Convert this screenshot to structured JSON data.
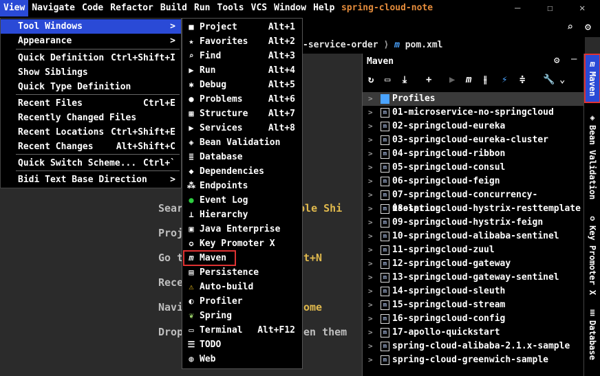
{
  "menubar": {
    "items": [
      "View",
      "Navigate",
      "Code",
      "Refactor",
      "Build",
      "Run",
      "Tools",
      "VCS",
      "Window",
      "Help"
    ],
    "app_title": "spring-cloud-note",
    "minimize": "—",
    "maximize": "☐",
    "close": "✕"
  },
  "breadcrumb": {
    "part1": "-service-order",
    "sep": "⟩",
    "logo": "m",
    "file": "pom.xml"
  },
  "editor_hints": {
    "h1a": "Sear",
    "h1b": "uble Shi",
    "h2": "Proj",
    "h3a": "Go t",
    "h3b": "t+N",
    "h4": "Rece",
    "h5a": "Navi",
    "h5b": "ome",
    "h6a": "Drop",
    "h6b": "en them"
  },
  "view_menu": {
    "items": [
      {
        "label": "Tool Windows",
        "shortcut": "",
        "arrow": ">"
      },
      {
        "label": "Appearance",
        "shortcut": "",
        "arrow": ">"
      },
      {
        "label": "Quick Definition",
        "shortcut": "Ctrl+Shift+I"
      },
      {
        "label": "Show Siblings",
        "shortcut": ""
      },
      {
        "label": "Quick Type Definition",
        "shortcut": ""
      },
      {
        "label": "Recent Files",
        "shortcut": "Ctrl+E"
      },
      {
        "label": "Recently Changed Files",
        "shortcut": ""
      },
      {
        "label": "Recent Locations",
        "shortcut": "Ctrl+Shift+E"
      },
      {
        "label": "Recent Changes",
        "shortcut": "Alt+Shift+C"
      },
      {
        "label": "Quick Switch Scheme...",
        "shortcut": "Ctrl+`"
      },
      {
        "label": "Bidi Text Base Direction",
        "shortcut": "",
        "arrow": ">"
      }
    ]
  },
  "tool_windows_menu": {
    "items": [
      {
        "label": "Project",
        "shortcut": "Alt+1",
        "icon": "■"
      },
      {
        "label": "Favorites",
        "shortcut": "Alt+2",
        "icon": "★"
      },
      {
        "label": "Find",
        "shortcut": "Alt+3",
        "icon": "⌕"
      },
      {
        "label": "Run",
        "shortcut": "Alt+4",
        "icon": "▶"
      },
      {
        "label": "Debug",
        "shortcut": "Alt+5",
        "icon": "✱"
      },
      {
        "label": "Problems",
        "shortcut": "Alt+6",
        "icon": "●"
      },
      {
        "label": "Structure",
        "shortcut": "Alt+7",
        "icon": "▦"
      },
      {
        "label": "Services",
        "shortcut": "Alt+8",
        "icon": "▶"
      },
      {
        "label": "Bean Validation",
        "shortcut": "",
        "icon": "◈"
      },
      {
        "label": "Database",
        "shortcut": "",
        "icon": "≣"
      },
      {
        "label": "Dependencies",
        "shortcut": "",
        "icon": "◆"
      },
      {
        "label": "Endpoints",
        "shortcut": "",
        "icon": "⁂"
      },
      {
        "label": "Event Log",
        "shortcut": "",
        "icon": "●"
      },
      {
        "label": "Hierarchy",
        "shortcut": "",
        "icon": "⊥"
      },
      {
        "label": "Java Enterprise",
        "shortcut": "",
        "icon": "▣"
      },
      {
        "label": "Key Promoter X",
        "shortcut": "",
        "icon": "✪"
      },
      {
        "label": "Maven",
        "shortcut": "",
        "icon": "m"
      },
      {
        "label": "Persistence",
        "shortcut": "",
        "icon": "▤"
      },
      {
        "label": "Auto-build",
        "shortcut": "",
        "icon": "⚠"
      },
      {
        "label": "Profiler",
        "shortcut": "",
        "icon": "◐"
      },
      {
        "label": "Spring",
        "shortcut": "",
        "icon": "❦"
      },
      {
        "label": "Terminal",
        "shortcut": "Alt+F12",
        "icon": "▭"
      },
      {
        "label": "TODO",
        "shortcut": "",
        "icon": "☰"
      },
      {
        "label": "Web",
        "shortcut": "",
        "icon": "◍"
      }
    ]
  },
  "maven": {
    "title": "Maven",
    "profiles_label": "Profiles",
    "projects": [
      "01-microservice-no-springcloud",
      "02-springcloud-eureka",
      "03-springcloud-eureka-cluster",
      "04-springcloud-ribbon",
      "05-springcloud-consul",
      "06-springcloud-feign",
      "07-springcloud-concurrency-isolation",
      "08-springcloud-hystrix-resttemplate",
      "09-springcloud-hystrix-feign",
      "10-springcloud-alibaba-sentinel",
      "11-springcloud-zuul",
      "12-springcloud-gateway",
      "13-springcloud-gateway-sentinel",
      "14-springcloud-sleuth",
      "15-springcloud-stream",
      "16-springcloud-config",
      "17-apollo-quickstart",
      "spring-cloud-alibaba-2.1.x-sample",
      "spring-cloud-greenwich-sample"
    ]
  },
  "right_strip": {
    "maven": "Maven",
    "bean_validation": "Bean Validation",
    "key_promoter": "Key Promoter X",
    "database": "Database"
  },
  "colors": {
    "accent": "#2a4ad6",
    "highlight_border": "#e03232",
    "title_orange": "#e38b3b"
  }
}
